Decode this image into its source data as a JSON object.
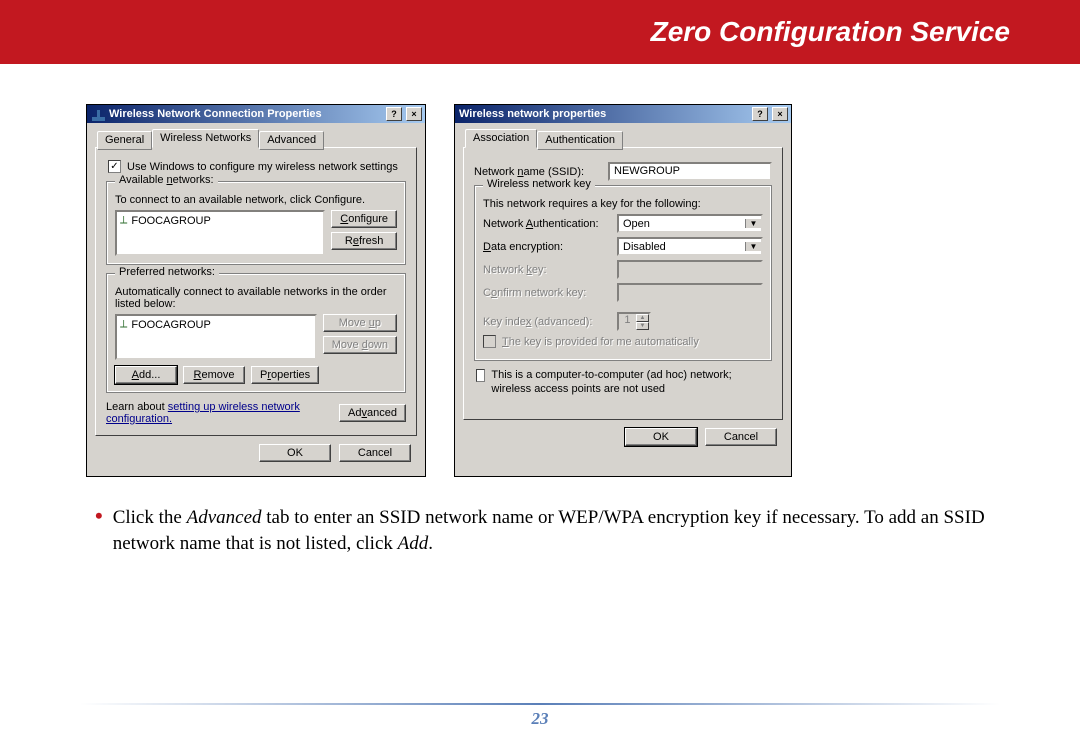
{
  "header": {
    "title": "Zero Configuration Service"
  },
  "dialogA": {
    "title": "Wireless Network Connection Properties",
    "help_btn": "?",
    "close_btn": "×",
    "tabs": {
      "general": "General",
      "wireless": "Wireless Networks",
      "advanced": "Advanced"
    },
    "use_windows": "Use Windows to configure my wireless network settings",
    "available": {
      "label": "Available networks:",
      "hint": "To connect to an available network, click Configure.",
      "item": "FOOCAGROUP",
      "configure": "Configure",
      "refresh": "Refresh"
    },
    "preferred": {
      "label": "Preferred networks:",
      "hint": "Automatically connect to available networks in the order listed below:",
      "item": "FOOCAGROUP",
      "moveup": "Move up",
      "movedown": "Move down",
      "add": "Add...",
      "remove": "Remove",
      "properties": "Properties"
    },
    "learn_prefix": "Learn about ",
    "learn_link": "setting up wireless network configuration.",
    "advanced_btn": "Advanced",
    "ok": "OK",
    "cancel": "Cancel"
  },
  "dialogB": {
    "title": "Wireless network properties",
    "help_btn": "?",
    "close_btn": "×",
    "tabs": {
      "assoc": "Association",
      "auth": "Authentication"
    },
    "ssid_label": "Network name (SSID):",
    "ssid_value": "NEWGROUP",
    "wkey": {
      "group": "Wireless network key",
      "hint": "This network requires a key for the following:",
      "auth_label": "Network Authentication:",
      "auth_value": "Open",
      "enc_label": "Data encryption:",
      "enc_value": "Disabled",
      "netkey_label": "Network key:",
      "confirm_label": "Confirm network key:",
      "keyidx_label": "Key index (advanced):",
      "keyidx_value": "1",
      "provided": "The key is provided for me automatically"
    },
    "adhoc": "This is a computer-to-computer (ad hoc) network; wireless access points are not used",
    "ok": "OK",
    "cancel": "Cancel"
  },
  "instruction": {
    "part1": "Click the ",
    "adv": "Advanced",
    "part2": " tab to enter an SSID network name or WEP/WPA encryption key if necessary.  To add an SSID network name that is not listed, click ",
    "add": "Add",
    "part3": "."
  },
  "page_number": "23"
}
